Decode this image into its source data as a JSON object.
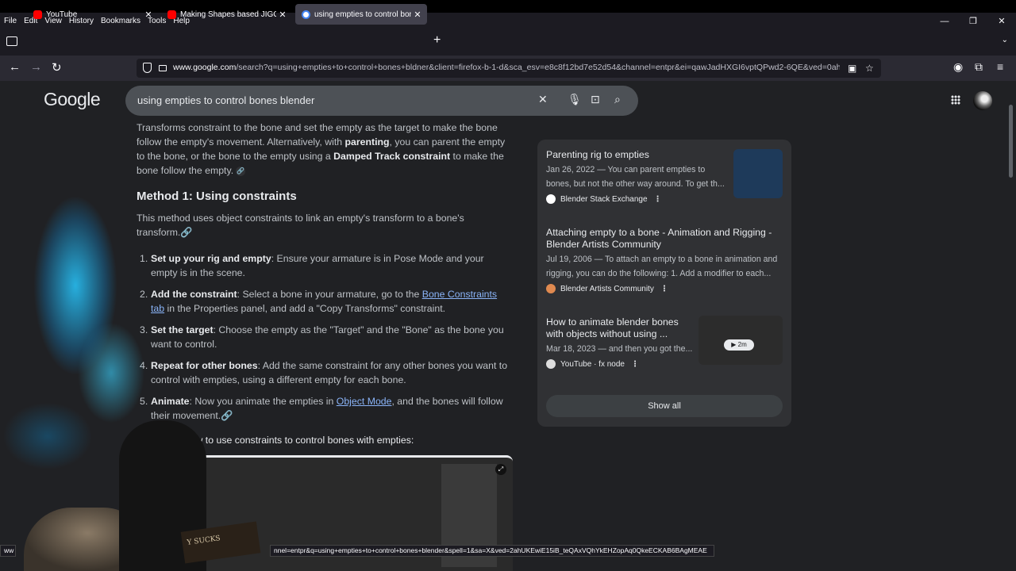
{
  "menu": [
    "File",
    "Edit",
    "View",
    "History",
    "Bookmarks",
    "Tools",
    "Help"
  ],
  "tabs": [
    {
      "title": "YouTube"
    },
    {
      "title": "Making Shapes based JIGGLE C"
    },
    {
      "title": "using empties to control bones"
    }
  ],
  "url": {
    "domain": "www.google.com",
    "rest": "/search?q=using+empties+to+control+bones+bldner&client=firefox-b-1-d&sca_esv=e8c8f12bd7e52d54&channel=entpr&ei=qawJadHXGI6vptQPwd2-6QE&ved=0ah"
  },
  "google": {
    "logo": "Google",
    "query": "using empties to control bones blender"
  },
  "article": {
    "intro_1": "Transforms constraint to the bone and set the empty as the target to make the bone follow the empty's movement. Alternatively, with ",
    "intro_bold1": "parenting",
    "intro_2": ", you can parent the empty to the bone, or the bone to the empty using a ",
    "intro_bold2": "Damped Track constraint",
    "intro_3": " to make the bone follow the empty.",
    "heading": "Method 1: Using constraints",
    "para_1": "This method uses ",
    "para_link": "object constraints",
    "para_2": " to link an empty's transform to a bone's transform.",
    "steps": [
      {
        "num": "1.",
        "bold_a": "Set up",
        "mid_a": " ",
        "bold_b": "your rig and empty",
        "text": ": Ensure your armature is in Pose Mode and your empty is in the scene."
      },
      {
        "num": "2.",
        "bold_a": "Add the",
        "mid_a": " ",
        "bold_b": "constraint",
        "text": ": Select a bone in your armature, go to the ",
        "link": "Bone Constraints tab",
        "text2": " in the Properties panel, and add a \"Copy Transforms\" constraint."
      },
      {
        "num": "3.",
        "bold_a": "Set the target",
        "text": ": Choose the empty as the \"Target\" and the \"Bone\" as the bone you want to control."
      },
      {
        "num": "4.",
        "bold_a": "Repeat for other bones",
        "text": ": Add the same constraint for any other bones you want to control with empties, using a different empty for each bone."
      },
      {
        "num": "5.",
        "bold_a": "Animate",
        "text": ": Now you   animate the empties in ",
        "link": "Object Mode",
        "text2": ", and the bones will follow their movement."
      }
    ],
    "video_caption": "nonstrates how to use constraints to control bones with empties:"
  },
  "sidebar": {
    "items": [
      {
        "title": "Parenting rig to empties",
        "snippet": "Jan 26, 2022 — You can parent empties to bones, but not the other way around. To get th...",
        "source": "Blender Stack Exchange"
      },
      {
        "title": "Attaching empty to a bone - Animation and Rigging - Blender Artists Community",
        "snippet": "Jul 19, 2006 — To attach an empty to a bone in animation and rigging, you can do the following: 1. Add a modifier to each...",
        "source": "Blender Artists Community"
      },
      {
        "title": "How to animate blender bones with objects without using ...",
        "snippet": "Mar 18, 2023 — and then you got the...",
        "source": "YouTube · fx node",
        "duration": "2m"
      }
    ],
    "show_all": "Show all"
  },
  "overlay": {
    "shirt_text": "Y SUCKS"
  },
  "status": {
    "left": "ww",
    "main": "nnel=entpr&q=using+empties+to+control+bones+blender&spell=1&sa=X&ved=2ahUKEwiE15iB_teQAxVQhYkEHZopAq0QkeECKAB6BAgMEAE"
  },
  "colors": {
    "page_bg": "#202124",
    "panel_bg": "#303134",
    "link": "#8ab4f8",
    "glow": "#28c8ff"
  }
}
